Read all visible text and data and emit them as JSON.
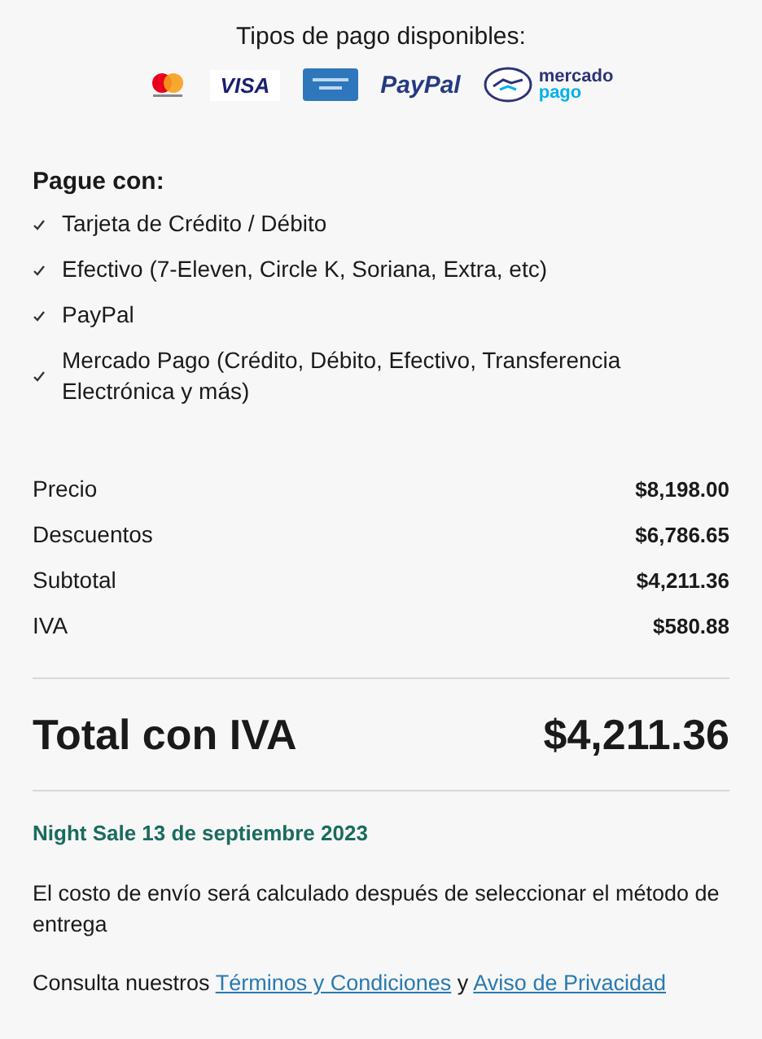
{
  "payment_types": {
    "title": "Tipos de pago disponibles:",
    "logos": [
      {
        "kind": "mastercard"
      },
      {
        "kind": "visa",
        "text": "VISA"
      },
      {
        "kind": "amex"
      },
      {
        "kind": "paypal",
        "text": "PayPal"
      },
      {
        "kind": "mercadopago",
        "text": "mercado",
        "subtext": "pago"
      }
    ]
  },
  "pay_with": {
    "title": "Pague con:",
    "items": [
      "Tarjeta de Crédito / Débito",
      "Efectivo (7-Eleven, Circle K, Soriana, Extra, etc)",
      "PayPal",
      "Mercado Pago (Crédito, Débito, Efectivo, Transferencia Electrónica y más)"
    ]
  },
  "summary": [
    {
      "label": "Precio",
      "value": "$8,198.00"
    },
    {
      "label": "Descuentos",
      "value": "$6,786.65"
    },
    {
      "label": "Subtotal",
      "value": "$4,211.36"
    },
    {
      "label": "IVA",
      "value": "$580.88"
    }
  ],
  "total": {
    "label": "Total con IVA",
    "value": "$4,211.36"
  },
  "promo": "Night Sale 13 de septiembre 2023",
  "shipping_note": "El costo de envío será calculado después de seleccionar el método de entrega",
  "legal": {
    "before": "Consulta nuestros",
    "link_1": "Términos y Condiciones",
    "between": "y",
    "link_2": "Aviso de Privacidad"
  }
}
